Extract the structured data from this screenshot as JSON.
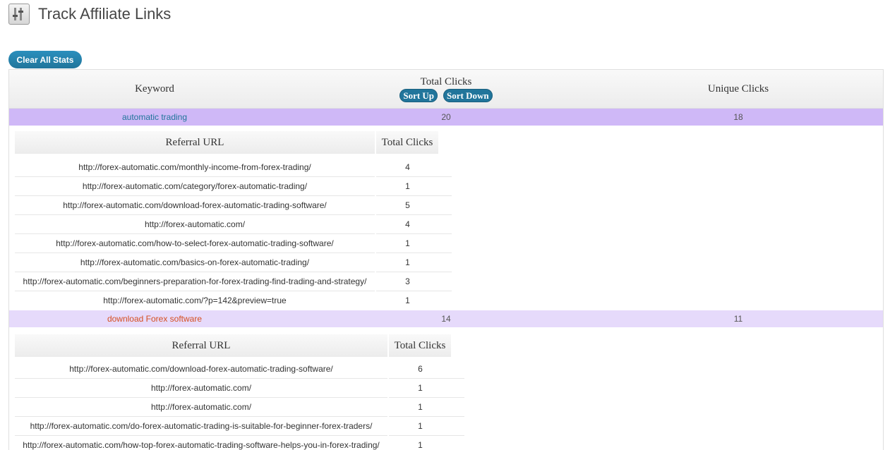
{
  "header": {
    "title": "Track Affiliate Links",
    "icon": "settings-sliders-icon"
  },
  "toolbar": {
    "clear_label": "Clear All Stats"
  },
  "columns": {
    "keyword": "Keyword",
    "total_clicks": "Total Clicks",
    "unique_clicks": "Unique Clicks",
    "sort_up": "Sort Up",
    "sort_down": "Sort Down"
  },
  "sub_columns": {
    "referral_url": "Referral URL",
    "total_clicks": "Total Clicks"
  },
  "colors": {
    "accent": "#21759b",
    "row1_bg": "#cfb8f7",
    "row2_bg": "#e6dafb",
    "link1": "#21759b",
    "link2": "#d54e21"
  },
  "keywords": [
    {
      "keyword": "automatic trading",
      "total": "20",
      "unique": "18",
      "referrals": [
        {
          "url": "http://forex-automatic.com/monthly-income-from-forex-trading/",
          "clicks": "4"
        },
        {
          "url": "http://forex-automatic.com/category/forex-automatic-trading/",
          "clicks": "1"
        },
        {
          "url": "http://forex-automatic.com/download-forex-automatic-trading-software/",
          "clicks": "5"
        },
        {
          "url": "http://forex-automatic.com/",
          "clicks": "4"
        },
        {
          "url": "http://forex-automatic.com/how-to-select-forex-automatic-trading-software/",
          "clicks": "1"
        },
        {
          "url": "http://forex-automatic.com/basics-on-forex-automatic-trading/",
          "clicks": "1"
        },
        {
          "url": "http://forex-automatic.com/beginners-preparation-for-forex-trading-find-trading-and-strategy/",
          "clicks": "3"
        },
        {
          "url": "http://forex-automatic.com/?p=142&preview=true",
          "clicks": "1"
        }
      ]
    },
    {
      "keyword": "download Forex software",
      "total": "14",
      "unique": "11",
      "referrals": [
        {
          "url": "http://forex-automatic.com/download-forex-automatic-trading-software/",
          "clicks": "6"
        },
        {
          "url": "http://forex-automatic.com/",
          "clicks": "1"
        },
        {
          "url": "http://forex-automatic.com/",
          "clicks": "1"
        },
        {
          "url": "http://forex-automatic.com/do-forex-automatic-trading-is-suitable-for-beginner-forex-traders/",
          "clicks": "1"
        },
        {
          "url": "http://forex-automatic.com/how-top-forex-automatic-trading-software-helps-you-in-forex-trading/",
          "clicks": "1"
        }
      ]
    }
  ]
}
